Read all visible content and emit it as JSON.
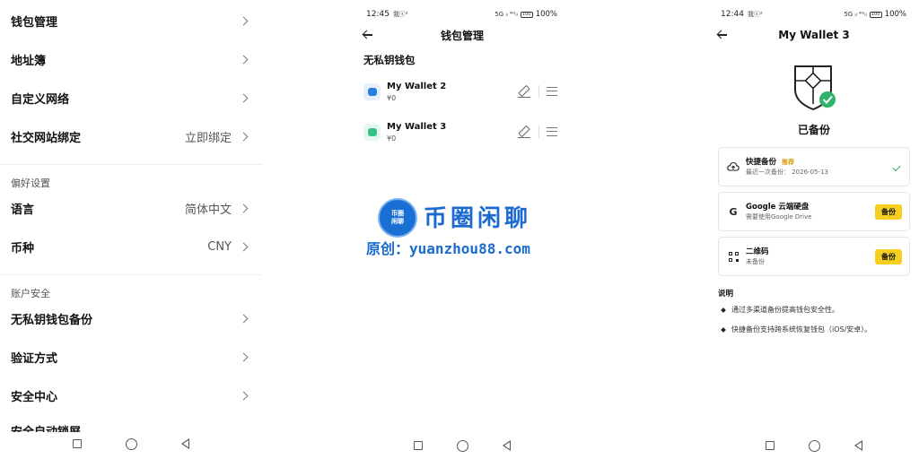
{
  "screen1": {
    "rows_top": [
      {
        "label": "钱包管理",
        "value": ""
      },
      {
        "label": "地址簿",
        "value": ""
      },
      {
        "label": "自定义网络",
        "value": ""
      },
      {
        "label": "社交网站绑定",
        "value": "立即绑定"
      }
    ],
    "preferences_title": "偏好设置",
    "rows_pref": [
      {
        "label": "语言",
        "value": "简体中文"
      },
      {
        "label": "币种",
        "value": "CNY"
      }
    ],
    "security_title": "账户安全",
    "rows_security": [
      {
        "label": "无私钥钱包备份",
        "value": ""
      },
      {
        "label": "验证方式",
        "value": ""
      },
      {
        "label": "安全中心",
        "value": ""
      }
    ],
    "cut_row_label": "安全自动锁屏"
  },
  "screen2": {
    "status_time": "12:45",
    "status_small_icons": "我ⓢ²",
    "status_signal": "5G ᵢₗ ⁴ᴳᵢₗ",
    "battery_label": "100",
    "battery_percent": "100%",
    "title": "钱包管理",
    "section_title": "无私钥钱包",
    "wallets": [
      {
        "name": "My Wallet 2",
        "balance": "¥0",
        "avatar_color": "#2a7fe0",
        "avatar_bg": "#e6f0fc"
      },
      {
        "name": "My Wallet 3",
        "balance": "¥0",
        "avatar_color": "#35c28a",
        "avatar_bg": "#e5f7ef"
      }
    ]
  },
  "watermark": {
    "logo_line1": "币圈",
    "logo_line2": "闲聊",
    "title": "币圈闲聊",
    "subtitle": "原创：yuanzhou88.com"
  },
  "screen3": {
    "status_time": "12:44",
    "status_small_icons": "我ⓢ²",
    "status_signal": "5G ᵢₗ ⁴ᴳᵢₗ",
    "battery_label": "100",
    "battery_percent": "100%",
    "title": "My Wallet 3",
    "backup_status": "已备份",
    "cards": [
      {
        "title": "快捷备份",
        "tag": "推荐",
        "subtitle": "最近一次备份：  2026-05-13",
        "icon": "cloud-upload-icon",
        "action": "check"
      },
      {
        "title": "Google 云端硬盘",
        "tag": "",
        "subtitle": "需要使用Google Drive",
        "icon": "google-icon",
        "action_label": "备份"
      },
      {
        "title": "二维码",
        "tag": "",
        "subtitle": "未备份",
        "icon": "qr-code-icon",
        "action_label": "备份"
      }
    ],
    "notes_title": "说明",
    "notes": [
      "通过多渠道备份提高钱包安全性。",
      "快捷备份支持跨系统恢复钱包（iOS/安卓）。"
    ],
    "accent_color": "#f6ce20",
    "success_color": "#2fb36a"
  }
}
